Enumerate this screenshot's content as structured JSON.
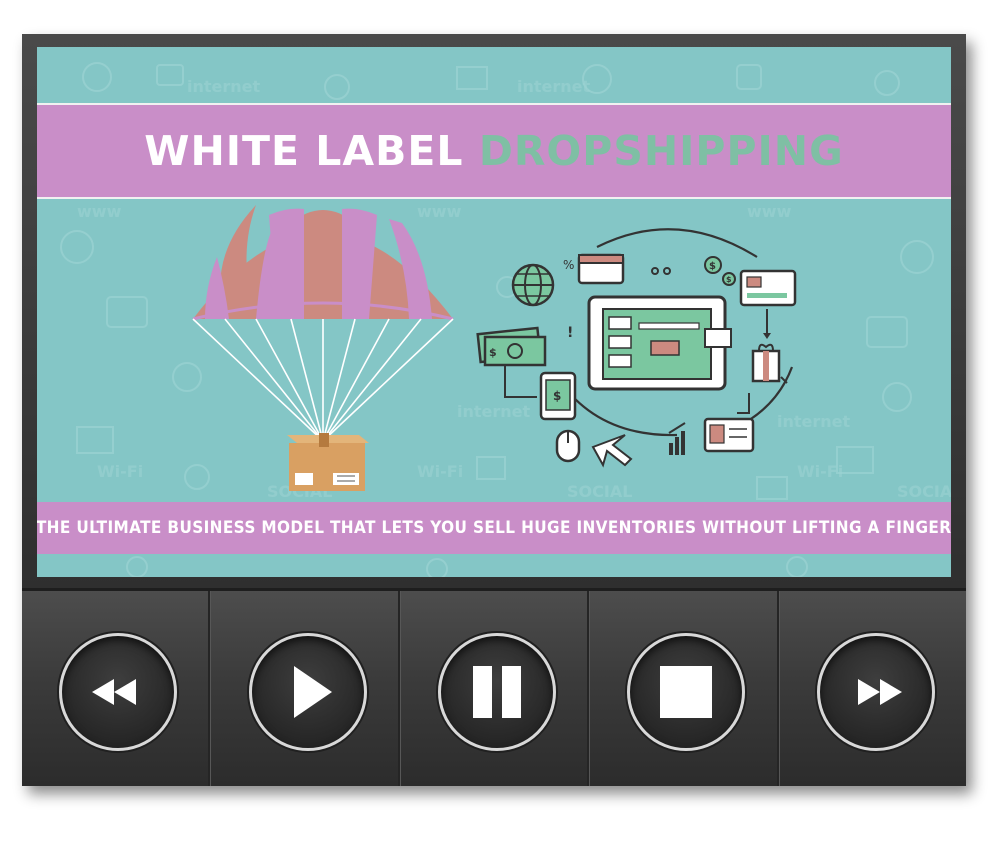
{
  "slide": {
    "title_part1": "WHITE LABEL",
    "title_part2": "DROPSHIPPING",
    "subtitle": "THE ULTIMATE BUSINESS MODEL THAT LETS YOU SELL HUGE INVENTORIES WITHOUT LIFTING A FINGER",
    "illustration": [
      "parachute-icon",
      "package-box-icon",
      "ecommerce-tablet-icon",
      "globe-icon",
      "wallet-icon",
      "cash-icon",
      "smartphone-icon",
      "mouse-icon",
      "cursor-icon",
      "credit-card-icon",
      "gift-icon",
      "id-card-icon",
      "bar-chart-icon",
      "dollar-coin-icon"
    ]
  },
  "controls": [
    {
      "name": "rewind-button",
      "icon": "rewind-icon"
    },
    {
      "name": "play-button",
      "icon": "play-icon"
    },
    {
      "name": "pause-button",
      "icon": "pause-icon"
    },
    {
      "name": "stop-button",
      "icon": "stop-icon"
    },
    {
      "name": "fast-forward-button",
      "icon": "fast-forward-icon"
    }
  ],
  "colors": {
    "screen_bg": "#84c6c6",
    "band": "#c98ec8",
    "title_accent": "#7fbfa4",
    "player_body": "#3a3a3a"
  }
}
